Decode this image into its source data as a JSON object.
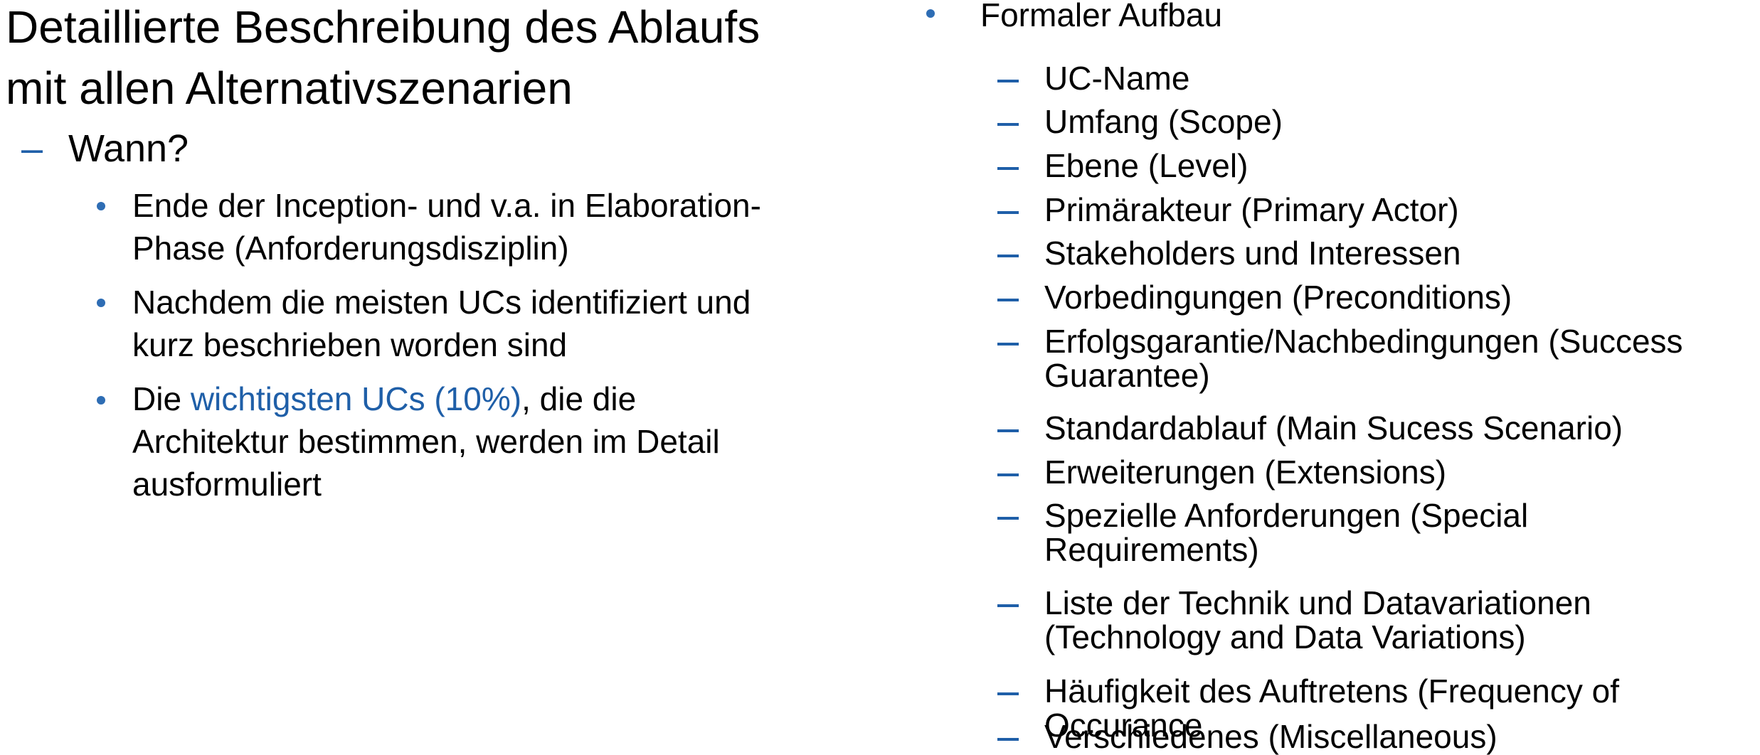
{
  "left": {
    "heading": [
      "Detaillierte Beschreibung des Ablaufs",
      "mit allen Alternativszenarien"
    ],
    "dash_item": "Wann?",
    "bullets": [
      {
        "lines": [
          "Ende der Inception- und v.a. in Elaboration-",
          "Phase (Anforderungsdisziplin)"
        ]
      },
      {
        "lines": [
          "Nachdem die meisten UCs identifiziert und",
          "kurz beschrieben worden sind"
        ]
      },
      {
        "prefix": "Die ",
        "highlight": "wichtigsten UCs (10%)",
        "suffix": ", die die",
        "lines": [
          "Architektur bestimmen, werden im Detail",
          "ausformuliert"
        ]
      }
    ]
  },
  "right": {
    "bullet_label": "Formaler Aufbau",
    "items": [
      {
        "lines": [
          "UC-Name"
        ]
      },
      {
        "lines": [
          "Umfang (Scope)"
        ]
      },
      {
        "lines": [
          "Ebene (Level)"
        ]
      },
      {
        "lines": [
          "Primärakteur (Primary Actor)"
        ]
      },
      {
        "lines": [
          "Stakeholders und Interessen"
        ]
      },
      {
        "lines": [
          "Vorbedingungen (Preconditions)"
        ]
      },
      {
        "lines": [
          "Erfolgsgarantie/Nachbedingungen (Success",
          "Guarantee)"
        ]
      },
      {
        "lines": [
          "Standardablauf (Main Sucess Scenario)"
        ]
      },
      {
        "lines": [
          "Erweiterungen (Extensions)"
        ]
      },
      {
        "lines": [
          "Spezielle Anforderungen (Special",
          "Requirements)"
        ]
      },
      {
        "lines": [
          "Liste der Technik und Datavariationen",
          "(Technology and Data Variations)"
        ]
      },
      {
        "lines": [
          "Häufigkeit des Auftretens (Frequency of",
          "Occurance"
        ]
      },
      {
        "lines": [
          "Verschiedenes (Miscellaneous)"
        ]
      }
    ]
  },
  "colors": {
    "accent": "#1f5fa8",
    "bullet": "#2e6db4",
    "text": "#000000"
  }
}
